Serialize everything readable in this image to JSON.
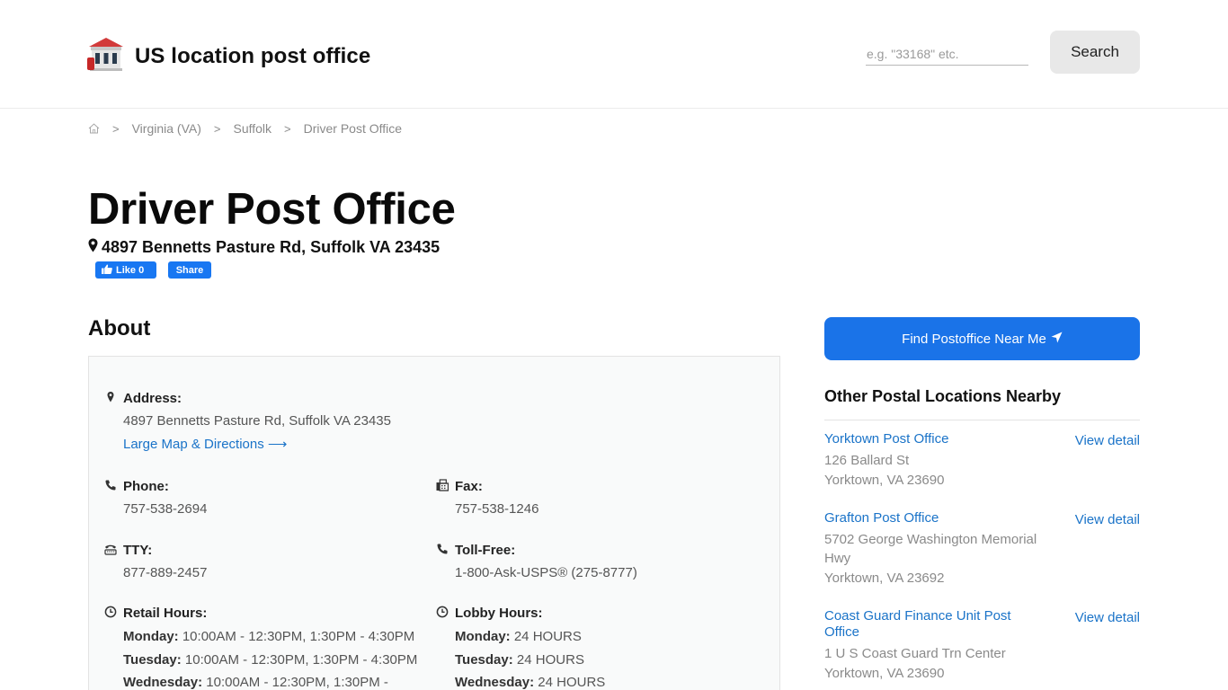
{
  "site": {
    "name": "US location post office"
  },
  "search": {
    "placeholder": "e.g. \"33168\" etc.",
    "button_label": "Search"
  },
  "breadcrumb": {
    "items": [
      "Virginia (VA)",
      "Suffolk",
      "Driver Post Office"
    ],
    "separator": ">"
  },
  "page": {
    "title": "Driver Post Office",
    "address": "4897 Bennetts Pasture Rd, Suffolk VA 23435"
  },
  "social": {
    "like_label": "Like 0",
    "share_label": "Share"
  },
  "about": {
    "heading": "About",
    "address_label": "Address:",
    "address_value": "4897 Bennetts Pasture Rd, Suffolk VA 23435",
    "map_link": "Large Map & Directions ⟶",
    "phone_label": "Phone:",
    "phone_value": "757-538-2694",
    "fax_label": "Fax:",
    "fax_value": "757-538-1246",
    "tty_label": "TTY:",
    "tty_value": "877-889-2457",
    "tollfree_label": "Toll-Free:",
    "tollfree_value": "1-800-Ask-USPS® (275-8777)",
    "retail_label": "Retail Hours:",
    "retail_hours": [
      {
        "day": "Monday:",
        "hours": "10:00AM - 12:30PM, 1:30PM - 4:30PM"
      },
      {
        "day": "Tuesday:",
        "hours": "10:00AM - 12:30PM, 1:30PM - 4:30PM"
      },
      {
        "day": "Wednesday:",
        "hours": "10:00AM - 12:30PM, 1:30PM -"
      }
    ],
    "lobby_label": "Lobby Hours:",
    "lobby_hours": [
      {
        "day": "Monday:",
        "hours": "24 HOURS"
      },
      {
        "day": "Tuesday:",
        "hours": "24 HOURS"
      },
      {
        "day": "Wednesday:",
        "hours": "24 HOURS"
      }
    ]
  },
  "sidebar": {
    "find_button": "Find Postoffice Near Me",
    "nearby_title": "Other Postal Locations Nearby",
    "view_detail_label": "View detail",
    "nearby": [
      {
        "name": "Yorktown Post Office",
        "address": "126 Ballard St",
        "city": "Yorktown, VA 23690"
      },
      {
        "name": "Grafton Post Office",
        "address": "5702 George Washington Memorial Hwy",
        "city": "Yorktown, VA 23692"
      },
      {
        "name": "Coast Guard Finance Unit Post Office",
        "address": "1 U S Coast Guard Trn Center",
        "city": "Yorktown, VA 23690"
      }
    ]
  },
  "colors": {
    "link": "#1a73c8",
    "primary_button": "#1a73e8",
    "facebook": "#1877f2",
    "logo_roof": "#d23b3b"
  },
  "icons": [
    "post-office-logo-icon",
    "home-icon",
    "map-marker-icon",
    "thumbs-up-icon",
    "phone-icon",
    "fax-icon",
    "tty-icon",
    "clock-icon",
    "location-arrow-icon"
  ]
}
